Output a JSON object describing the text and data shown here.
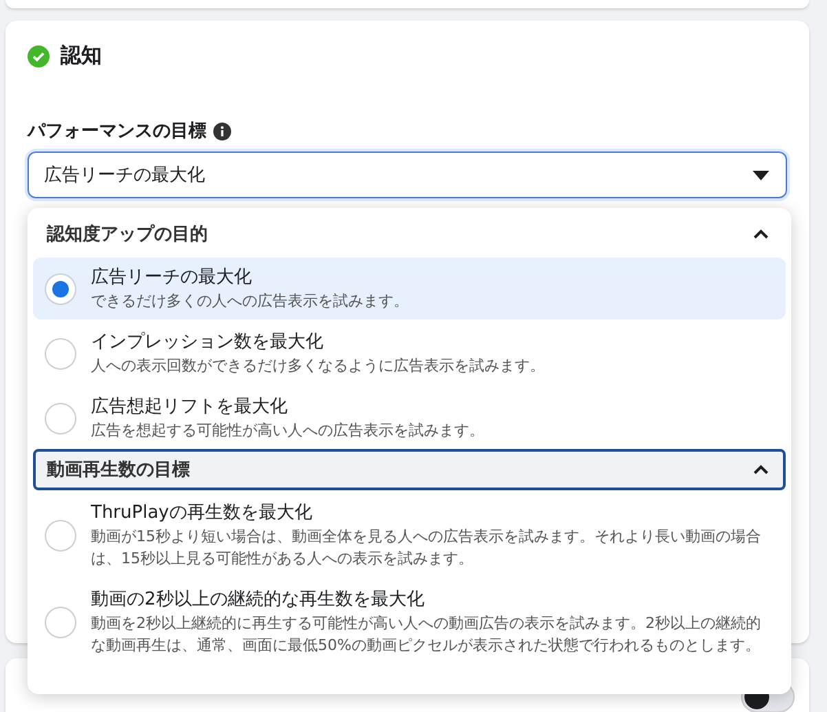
{
  "section": {
    "title": "認知",
    "complete": true
  },
  "next_section": {
    "toggle_on": false
  },
  "field": {
    "label": "パフォーマンスの目標",
    "value": "広告リーチの最大化",
    "focused": true,
    "open": true
  },
  "dropdown": {
    "groups": [
      {
        "title": "認知度アップの目的",
        "expanded": true,
        "focused": false,
        "options": [
          {
            "title": "広告リーチの最大化",
            "description": "できるだけ多くの人への広告表示を試みます。",
            "selected": true
          },
          {
            "title": "インプレッション数を最大化",
            "description": "人への表示回数ができるだけ多くなるように広告表示を試みます。",
            "selected": false
          },
          {
            "title": "広告想起リフトを最大化",
            "description": "広告を想起する可能性が高い人への広告表示を試みます。",
            "selected": false
          }
        ]
      },
      {
        "title": "動画再生数の目標",
        "expanded": true,
        "focused": true,
        "options": [
          {
            "title": "ThruPlayの再生数を最大化",
            "description": "動画が15秒より短い場合は、動画全体を見る人への広告表示を試みます。それより長い動画の場合は、15秒以上見る可能性がある人への表示を試みます。",
            "selected": false
          },
          {
            "title": "動画の2秒以上の継続的な再生数を最大化",
            "description": "動画を2秒以上継続的に再生する可能性が高い人への動画広告の表示を試みます。2秒以上の継続的な動画再生は、通常、画面に最低50%の動画ピクセルが表示された状態で行われるものとします。",
            "selected": false
          }
        ]
      }
    ]
  }
}
